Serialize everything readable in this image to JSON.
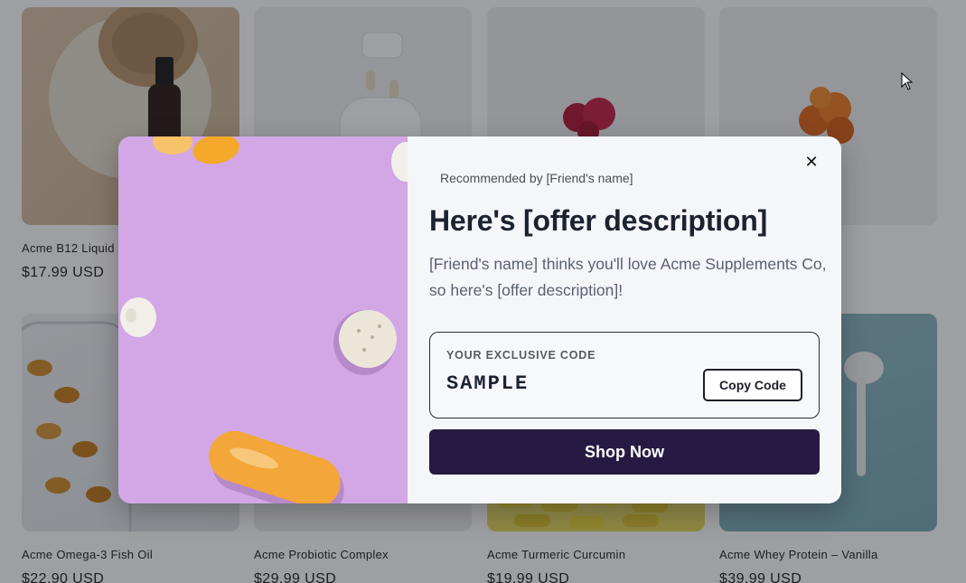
{
  "products": [
    {
      "title": "Acme B12 Liquid",
      "price": "$17.99 USD"
    },
    {
      "title": "",
      "price": ""
    },
    {
      "title": "",
      "price": ""
    },
    {
      "title": "",
      "price": ""
    },
    {
      "title": "Acme Omega-3 Fish Oil",
      "price": "$22.90 USD"
    },
    {
      "title": "Acme Probiotic Complex",
      "price": "$29.99 USD"
    },
    {
      "title": "Acme Turmeric Curcumin",
      "price": "$19.99 USD"
    },
    {
      "title": "Acme Whey Protein – Vanilla",
      "price": "$39.99 USD"
    }
  ],
  "modal": {
    "recommended": "Recommended by [Friend's name]",
    "headline": "Here's [offer description]",
    "description": "[Friend's name] thinks you'll love Acme Supplements Co, so here's [offer description]!",
    "code_label": "YOUR EXCLUSIVE CODE",
    "code_value": "SAMPLE",
    "copy_label": "Copy Code",
    "shop_label": "Shop Now",
    "close_glyph": "✕"
  },
  "colors": {
    "overlay": "#181a22",
    "modal_bg": "#f4f6f9",
    "primary_button": "#261a42",
    "hero_image_bg": "#d3a7e6"
  },
  "icons": [
    "close-icon",
    "mouse-cursor-icon"
  ]
}
